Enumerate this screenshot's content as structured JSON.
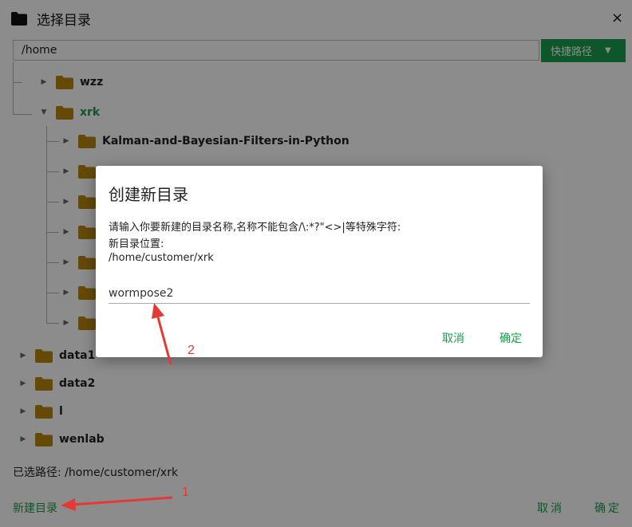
{
  "dialog_header": {
    "title": "选择目录",
    "close_glyph": "×"
  },
  "path_bar": {
    "value": "/home",
    "quick_path_label": "快捷路径"
  },
  "tree": {
    "wzz": "wzz",
    "xrk": "xrk",
    "child_kalman": "Kalman-and-Bayesian-Filters-in-Python",
    "data1": "data1",
    "data2": "data2",
    "l": "l",
    "wenlab": "wenlab"
  },
  "selected_path": "已选路径: /home/customer/xrk",
  "footer": {
    "new_dir": "新建目录",
    "cancel": "取消",
    "ok": "确定"
  },
  "new_dir_dialog": {
    "title": "创建新目录",
    "instruction": "请输入你要新建的目录名称,名称不能包含/\\:*?\"<>|等特殊字符:",
    "location_label": "新目录位置:",
    "location_path": "/home/customer/xrk",
    "input_value": "wormpose2",
    "cancel": "取消",
    "ok": "确定"
  },
  "annotations": {
    "marker1": "1",
    "marker2": "2"
  },
  "colors": {
    "accent": "#1b9e4d",
    "folder": "#b8860b",
    "annotation": "#e53935",
    "overlay": "rgba(0,0,0,0.45)"
  },
  "icons": {
    "header": "folder-icon",
    "tree": "folder-icon",
    "expand": "triangle-right-icon",
    "collapse": "triangle-down-icon"
  }
}
